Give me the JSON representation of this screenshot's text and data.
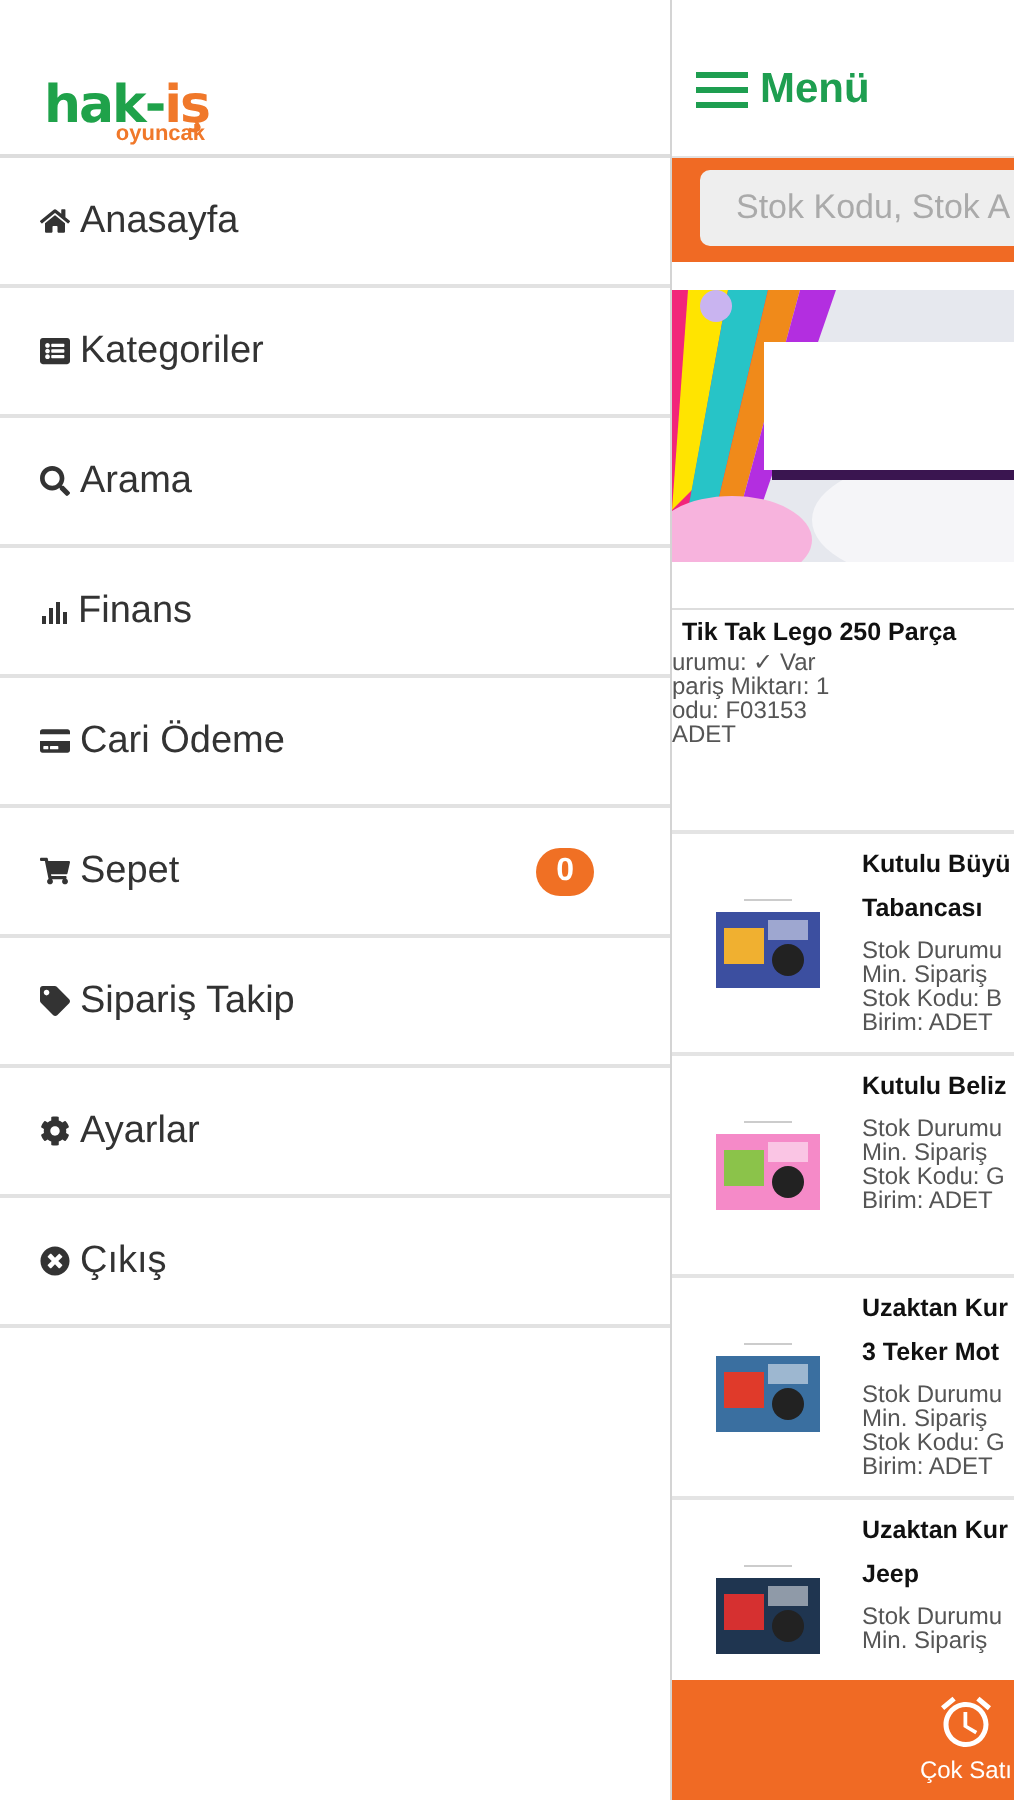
{
  "logo": {
    "parts": [
      {
        "text": "hak-",
        "color": "#1fa24a"
      },
      {
        "text": "iş",
        "color": "#f0782a"
      }
    ],
    "tagline": "oyuncak"
  },
  "sidebar": {
    "items": [
      {
        "label": "Anasayfa"
      },
      {
        "label": "Kategoriler"
      },
      {
        "label": "Arama"
      },
      {
        "label": "Finans"
      },
      {
        "label": "Cari Ödeme"
      },
      {
        "label": "Sepet",
        "badge": "0"
      },
      {
        "label": "Sipariş Takip"
      },
      {
        "label": "Ayarlar"
      },
      {
        "label": "Çıkış"
      }
    ]
  },
  "header": {
    "title": "Menü"
  },
  "search": {
    "placeholder": "Stok Kodu, Stok A"
  },
  "featured": {
    "title": "Tik Tak Lego 250 Parça",
    "lines": [
      "urumu: ✓ Var",
      "pariş Miktarı: 1",
      "odu: F03153",
      "ADET"
    ]
  },
  "products": [
    {
      "title_lines": [
        "Kutulu Büyü",
        "Tabancası"
      ],
      "lines": [
        "Stok Durumu",
        "Min. Sipariş",
        "Stok Kodu: B",
        "Birim: ADET"
      ]
    },
    {
      "title_lines": [
        "Kutulu Beliz"
      ],
      "lines": [
        "Stok Durumu",
        "Min. Sipariş",
        "Stok Kodu: G",
        "Birim: ADET"
      ]
    },
    {
      "title_lines": [
        "Uzaktan Kur",
        "3 Teker Mot"
      ],
      "lines": [
        "Stok Durumu",
        "Min. Sipariş",
        "Stok Kodu: G",
        "Birim: ADET"
      ]
    },
    {
      "title_lines": [
        "Uzaktan Kur",
        "Jeep"
      ],
      "lines": [
        "Stok Durumu",
        "Min. Sipariş"
      ]
    }
  ],
  "bottom_bar": {
    "label": "Çok Satı"
  }
}
